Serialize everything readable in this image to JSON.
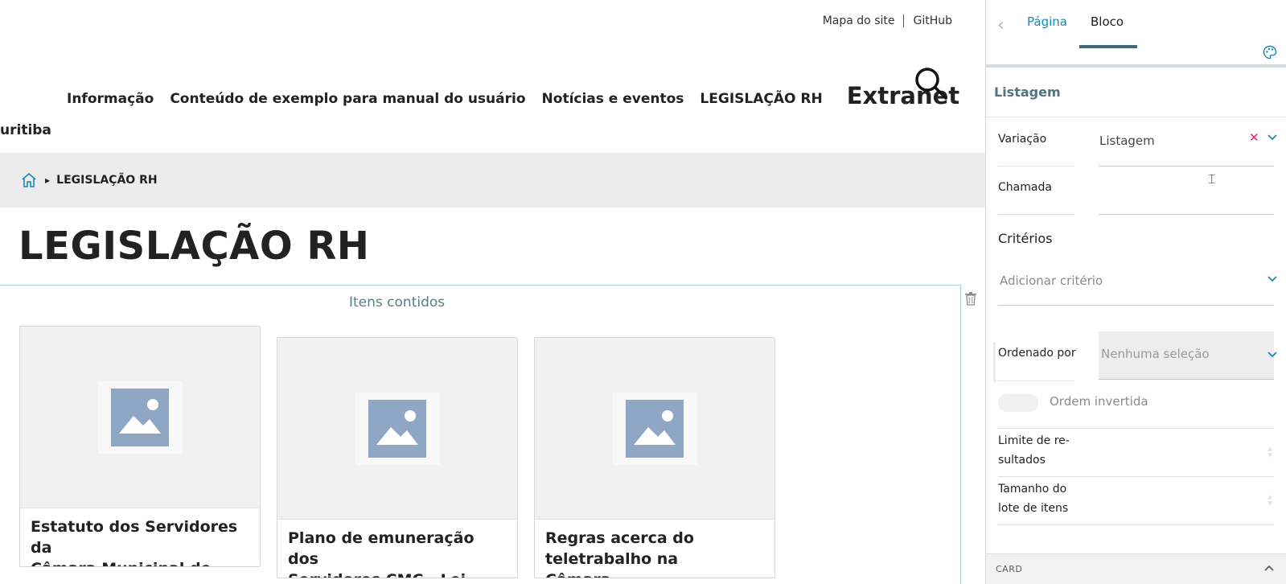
{
  "site": {
    "top_links": [
      "Mapa do site",
      "GitHub"
    ],
    "nav_items": [
      "Informação",
      "Conteúdo de exemplo para manual do usuário",
      "Notícias e eventos",
      "LEGISLAÇÃO RH"
    ],
    "nav_big": "Extranet",
    "nav_cut": "uritiba",
    "breadcrumb_current": "LEGISLAÇÃO RH",
    "page_title": "LEGISLAÇÃO RH",
    "block_heading": "Itens contidos",
    "cards": [
      {
        "title_line1": "Estatuto dos Servidores da",
        "title_line2": "Câmara Municipal de..."
      },
      {
        "title_line1": "Plano de emuneração dos",
        "title_line2": "Servidores CMC - Lei-..."
      },
      {
        "title_line1": "Regras acerca do",
        "title_line2": "teletrabalho na Câmara..."
      }
    ]
  },
  "sidebar": {
    "tabs": {
      "page": "Página",
      "block": "Bloco"
    },
    "section_title": "Listagem",
    "variation": {
      "label": "Variação",
      "value": "Listagem"
    },
    "chamada": {
      "label": "Chamada",
      "value": ""
    },
    "criteria": {
      "title": "Critérios",
      "placeholder": "Adicionar critério"
    },
    "sort": {
      "label": "Ordenado por",
      "placeholder": "Nenhuma seleção"
    },
    "reverse": {
      "label": "Ordem invertida",
      "on": false
    },
    "limit": {
      "label_line1": "Limite de re-",
      "label_line2": "sultados"
    },
    "batch": {
      "label_line1": "Tamanho do",
      "label_line2": "lote de itens"
    },
    "card_section": "CARD"
  },
  "colors": {
    "accent": "#1a87b3",
    "teal_dark": "#3e6c76",
    "clear_x": "#e0235c",
    "placeholder_image": "#8fa7c4"
  }
}
